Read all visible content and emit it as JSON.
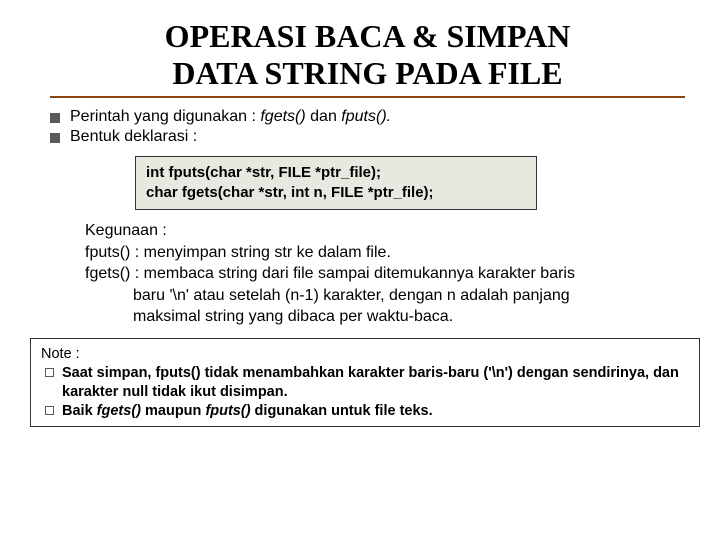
{
  "title_line1": "OPERASI BACA & SIMPAN",
  "title_line2": "DATA STRING PADA FILE",
  "bullets": {
    "b1_pre": "Perintah yang digunakan : ",
    "b1_i1": "fgets()",
    "b1_mid": " dan ",
    "b1_i2": "fputs().",
    "b2": "Bentuk deklarasi :"
  },
  "code": {
    "l1": "int fputs(char *str, FILE *ptr_file);",
    "l2": "char fgets(char *str, int n, FILE *ptr_file);"
  },
  "usage": {
    "u1": "Kegunaan :",
    "u2": "fputs() : menyimpan string str ke dalam file.",
    "u3": "fgets() : membaca string dari file sampai ditemukannya karakter baris",
    "u4": "baru '\\n' atau setelah (n-1) karakter, dengan n adalah panjang",
    "u5": "maksimal string yang dibaca per waktu-baca."
  },
  "note": {
    "head": "Note :",
    "n1a": "Saat simpan, fputs() tidak menambahkan karakter baris-baru ('\\n') dengan sendirinya, dan karakter null tidak ikut disimpan.",
    "n2a": "Baik ",
    "n2b": "fgets()",
    "n2c": " maupun ",
    "n2d": "fputs()",
    "n2e": " digunakan untuk file teks."
  }
}
